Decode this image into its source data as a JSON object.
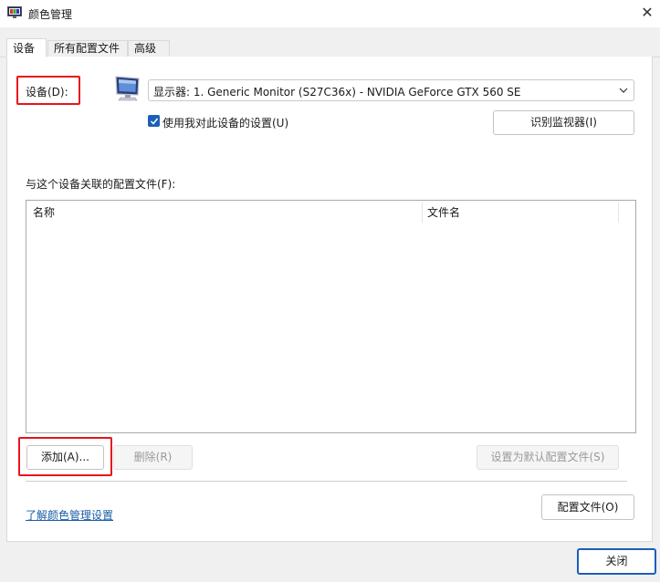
{
  "window": {
    "title": "颜色管理",
    "close_glyph": "✕"
  },
  "tabs": [
    {
      "label": "设备",
      "active": true
    },
    {
      "label": "所有配置文件",
      "active": false
    },
    {
      "label": "高级",
      "active": false
    }
  ],
  "device": {
    "label": "设备(D):",
    "selected": "显示器: 1. Generic Monitor (S27C36x) - NVIDIA GeForce GTX 560 SE",
    "use_settings_label": "使用我对此设备的设置(U)",
    "use_settings_checked": true,
    "identify_button": "识别监视器(I)"
  },
  "profiles": {
    "label": "与这个设备关联的配置文件(F):",
    "columns": [
      "名称",
      "文件名"
    ],
    "rows": []
  },
  "actions": {
    "add": "添加(A)...",
    "remove": "删除(R)",
    "set_default": "设置为默认配置文件(S)",
    "profiles_button": "配置文件(O)"
  },
  "link": {
    "learn_more": "了解颜色管理设置"
  },
  "footer": {
    "close": "关闭"
  },
  "colors": {
    "highlight_box": "#e8141a",
    "accent": "#1d5fb8",
    "link": "#1a5ca8"
  },
  "icons": {
    "app": "color-management-icon",
    "monitor": "monitor-icon",
    "dropdown": "chevron-down-icon",
    "checkbox": "checkmark-icon"
  }
}
